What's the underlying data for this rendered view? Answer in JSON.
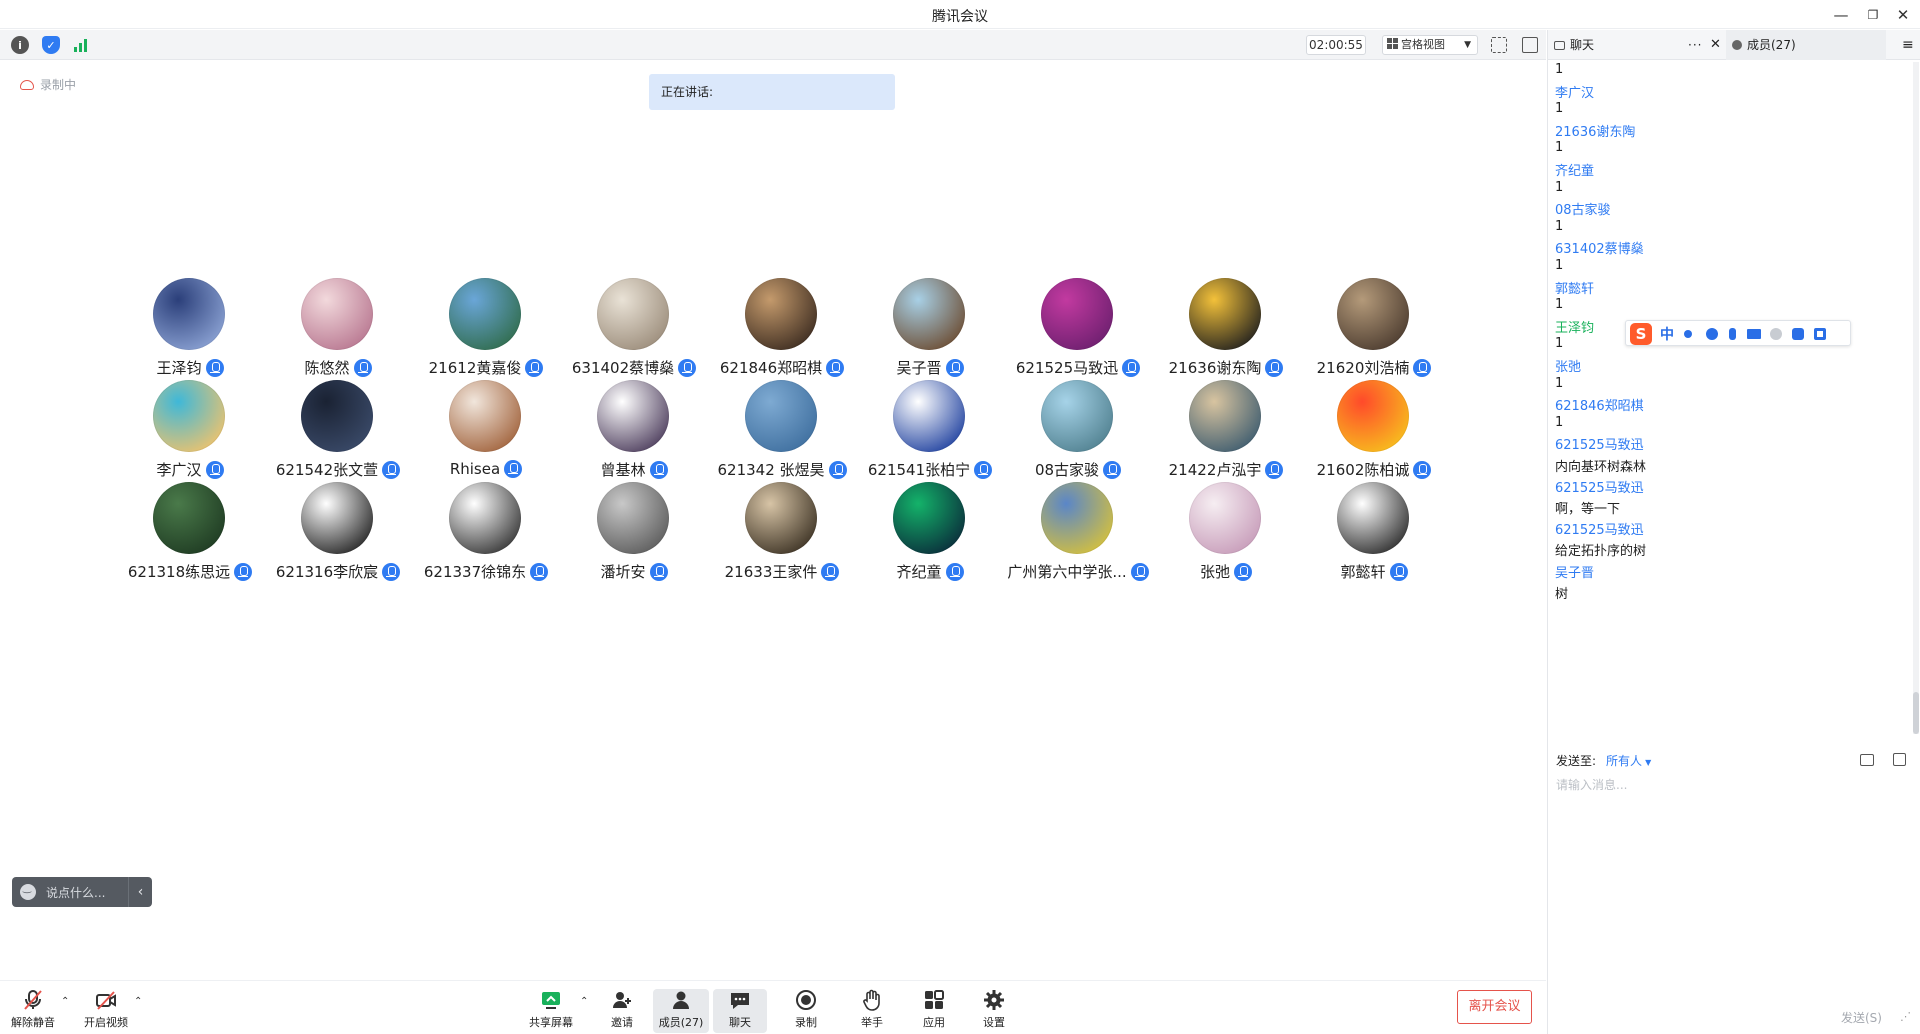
{
  "window": {
    "title": "腾讯会议"
  },
  "topbar": {
    "timer": "02:00:55",
    "view_label": "宫格视图"
  },
  "stage": {
    "recording_label": "录制中",
    "speaking_label": "正在讲话:",
    "participants": [
      {
        "name": "王泽钧",
        "c1": "#2b3f7a",
        "c2": "#8ea5d6"
      },
      {
        "name": "陈悠然",
        "c1": "#f2d9dc",
        "c2": "#b7758f"
      },
      {
        "name": "21612黄嘉俊",
        "c1": "#6aa6d8",
        "c2": "#2f6b4a"
      },
      {
        "name": "631402蔡博燊",
        "c1": "#e9e2d6",
        "c2": "#9a8b79"
      },
      {
        "name": "621846郑昭棋",
        "c1": "#c49a6c",
        "c2": "#3a2a1f"
      },
      {
        "name": "吴子晋",
        "c1": "#a8d0e6",
        "c2": "#6b4a2f"
      },
      {
        "name": "621525马致迅",
        "c1": "#c23aa0",
        "c2": "#6b1f6e"
      },
      {
        "name": "21636谢东陶",
        "c1": "#f3c13a",
        "c2": "#1e1e1e"
      },
      {
        "name": "21620刘浩楠",
        "c1": "#b49a7a",
        "c2": "#4a3a2e"
      },
      {
        "name": "李广汉",
        "c1": "#3fb8d8",
        "c2": "#f2c36b"
      },
      {
        "name": "621542张文萱",
        "c1": "#1a2233",
        "c2": "#3b4b6a"
      },
      {
        "name": "Rhisea",
        "c1": "#f1e6dc",
        "c2": "#a0613a"
      },
      {
        "name": "曾基林",
        "c1": "#ffffff",
        "c2": "#4a3a5a"
      },
      {
        "name": "621342 张煜昊",
        "c1": "#7eaad2",
        "c2": "#3e6e9e"
      },
      {
        "name": "621541张柏宁",
        "c1": "#ffffff",
        "c2": "#1d3f9e"
      },
      {
        "name": "08古家骏",
        "c1": "#a6d3e8",
        "c2": "#4f7f8e"
      },
      {
        "name": "21422卢泓宇",
        "c1": "#d8c4a0",
        "c2": "#3b5a6e"
      },
      {
        "name": "21602陈柏诚",
        "c1": "#ff4a2a",
        "c2": "#f7c21e"
      },
      {
        "name": "621318练思远",
        "c1": "#4a7a4a",
        "c2": "#1e3a22"
      },
      {
        "name": "621316李欣宸",
        "c1": "#ffffff",
        "c2": "#222222"
      },
      {
        "name": "621337徐锦东",
        "c1": "#ffffff",
        "c2": "#333333"
      },
      {
        "name": "潘圻安",
        "c1": "#c8c8c8",
        "c2": "#5a5a5a"
      },
      {
        "name": "21633王家件",
        "c1": "#d7c4a6",
        "c2": "#3a3022"
      },
      {
        "name": "齐纪童",
        "c1": "#14b36a",
        "c2": "#0a2a3a"
      },
      {
        "name": "广州第六中学张...",
        "c1": "#5a86c8",
        "c2": "#d8c23a"
      },
      {
        "name": "张弛",
        "c1": "#f6eef2",
        "c2": "#c69ab8"
      },
      {
        "name": "郭懿轩",
        "c1": "#ffffff",
        "c2": "#2a2a2a"
      }
    ]
  },
  "saybox": {
    "placeholder": "说点什么..."
  },
  "bottombar": {
    "unmute": "解除静音",
    "start_video": "开启视频",
    "share": "共享屏幕",
    "invite": "邀请",
    "members": "成员(27)",
    "chat": "聊天",
    "record": "录制",
    "raise_hand": "举手",
    "apps": "应用",
    "settings": "设置",
    "leave": "离开会议"
  },
  "panel": {
    "chat_tab": "聊天",
    "members_tab": "成员(27)",
    "messages": [
      {
        "type": "body",
        "text": "1"
      },
      {
        "type": "sender",
        "text": "李广汉"
      },
      {
        "type": "body",
        "text": "1"
      },
      {
        "type": "sender",
        "text": "21636谢东陶"
      },
      {
        "type": "body",
        "text": "1"
      },
      {
        "type": "sender",
        "text": "齐纪童"
      },
      {
        "type": "body",
        "text": "1"
      },
      {
        "type": "sender",
        "text": "08古家骏"
      },
      {
        "type": "body",
        "text": "1"
      },
      {
        "type": "sender",
        "text": "631402蔡博燊"
      },
      {
        "type": "body",
        "text": "1"
      },
      {
        "type": "sender",
        "text": "郭懿轩"
      },
      {
        "type": "body",
        "text": "1"
      },
      {
        "type": "sender-me",
        "text": "王泽钧"
      },
      {
        "type": "body",
        "text": "1"
      },
      {
        "type": "sender",
        "text": "张弛"
      },
      {
        "type": "body",
        "text": "1"
      },
      {
        "type": "sender",
        "text": "621846郑昭棋"
      },
      {
        "type": "body",
        "text": "1"
      },
      {
        "type": "sender",
        "text": "621525马致迅"
      },
      {
        "type": "body",
        "text": "内向基环树森林"
      },
      {
        "type": "sender",
        "text": "621525马致迅"
      },
      {
        "type": "body",
        "text": "啊，等一下"
      },
      {
        "type": "sender",
        "text": "621525马致迅"
      },
      {
        "type": "body",
        "text": "给定拓扑序的树"
      },
      {
        "type": "sender",
        "text": "吴子晋"
      },
      {
        "type": "body",
        "text": "树"
      }
    ],
    "send_to_label": "发送至:",
    "send_to_value": "所有人",
    "input_placeholder": "请输入消息...",
    "send_button": "发送(S)"
  },
  "ime": {
    "mode": "中"
  }
}
